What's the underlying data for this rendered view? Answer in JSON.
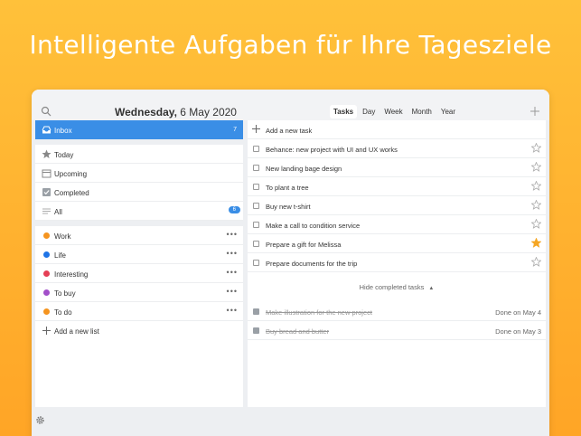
{
  "headline": "Intelligente Aufgaben für Ihre Tagesziele",
  "header": {
    "date_weekday": "Wednesday,",
    "date_rest": "6 May 2020",
    "tabs": [
      {
        "label": "Tasks",
        "active": true
      },
      {
        "label": "Day",
        "active": false
      },
      {
        "label": "Week",
        "active": false
      },
      {
        "label": "Month",
        "active": false
      },
      {
        "label": "Year",
        "active": false
      }
    ]
  },
  "sidebar": {
    "smart_lists": [
      {
        "label": "Inbox",
        "count": "7",
        "icon": "inbox-icon"
      },
      {
        "label": "Today",
        "icon": "star-icon"
      },
      {
        "label": "Upcoming",
        "icon": "calendar-icon"
      },
      {
        "label": "Completed",
        "icon": "checkbox-icon"
      },
      {
        "label": "All",
        "count": "6",
        "icon": "list-icon"
      }
    ],
    "lists": [
      {
        "label": "Work",
        "color": "#f5941f"
      },
      {
        "label": "Life",
        "color": "#1f74e6"
      },
      {
        "label": "Interesting",
        "color": "#e53f55"
      },
      {
        "label": "To buy",
        "color": "#a24fc9"
      },
      {
        "label": "To do",
        "color": "#f5941f"
      }
    ],
    "add_list": "Add a new list",
    "more_glyph": "•••"
  },
  "tasks": {
    "add_task": "Add a new task",
    "items": [
      {
        "label": "Behance: new project with UI and UX works",
        "starred": false
      },
      {
        "label": "New landing bage design",
        "starred": false
      },
      {
        "label": "To plant a tree",
        "starred": false
      },
      {
        "label": "Buy new t-shirt",
        "starred": false
      },
      {
        "label": "Make a call to condition service",
        "starred": false
      },
      {
        "label": "Prepare a gift for Melissa",
        "starred": true
      },
      {
        "label": "Prepare documents for the trip",
        "starred": false
      }
    ],
    "hide_completed": "Hide completed tasks",
    "completed": [
      {
        "label": "Make illustration for the new project",
        "done_on": "Done on May 4"
      },
      {
        "label": "Buy bread and butter",
        "done_on": "Done on May 3"
      }
    ]
  },
  "colors": {
    "accent": "#3a8ee6",
    "star_active": "#f5a623",
    "background_top": "#ffc13a",
    "background_bottom": "#ffa526"
  }
}
